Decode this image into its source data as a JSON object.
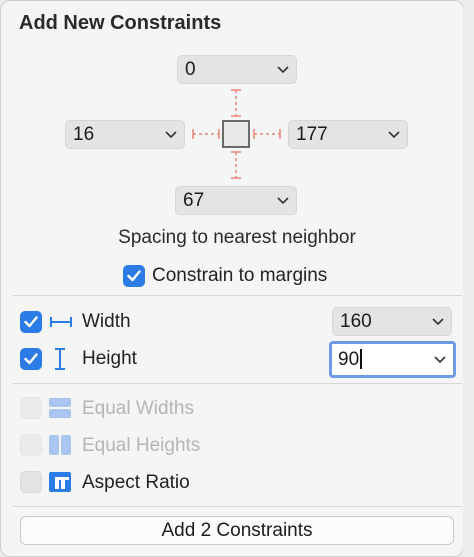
{
  "title": "Add New Constraints",
  "spacing": {
    "top": "0",
    "left": "16",
    "right": "177",
    "bottom": "67",
    "caption": "Spacing to nearest neighbor"
  },
  "constrain_margins": {
    "label": "Constrain to margins",
    "checked": true
  },
  "width": {
    "label": "Width",
    "value": "160",
    "checked": true,
    "icon": "width-icon"
  },
  "height": {
    "label": "Height",
    "value": "90",
    "checked": true,
    "icon": "height-icon"
  },
  "equal_widths": {
    "label": "Equal Widths",
    "checked": false,
    "enabled": false
  },
  "equal_heights": {
    "label": "Equal Heights",
    "checked": false,
    "enabled": false
  },
  "aspect_ratio": {
    "label": "Aspect Ratio",
    "checked": false,
    "enabled": true
  },
  "add_button": {
    "label": "Add 2 Constraints"
  },
  "colors": {
    "accent": "#2c7ce8",
    "strut": "#e8857a",
    "focus_ring": "#6e9be6"
  }
}
